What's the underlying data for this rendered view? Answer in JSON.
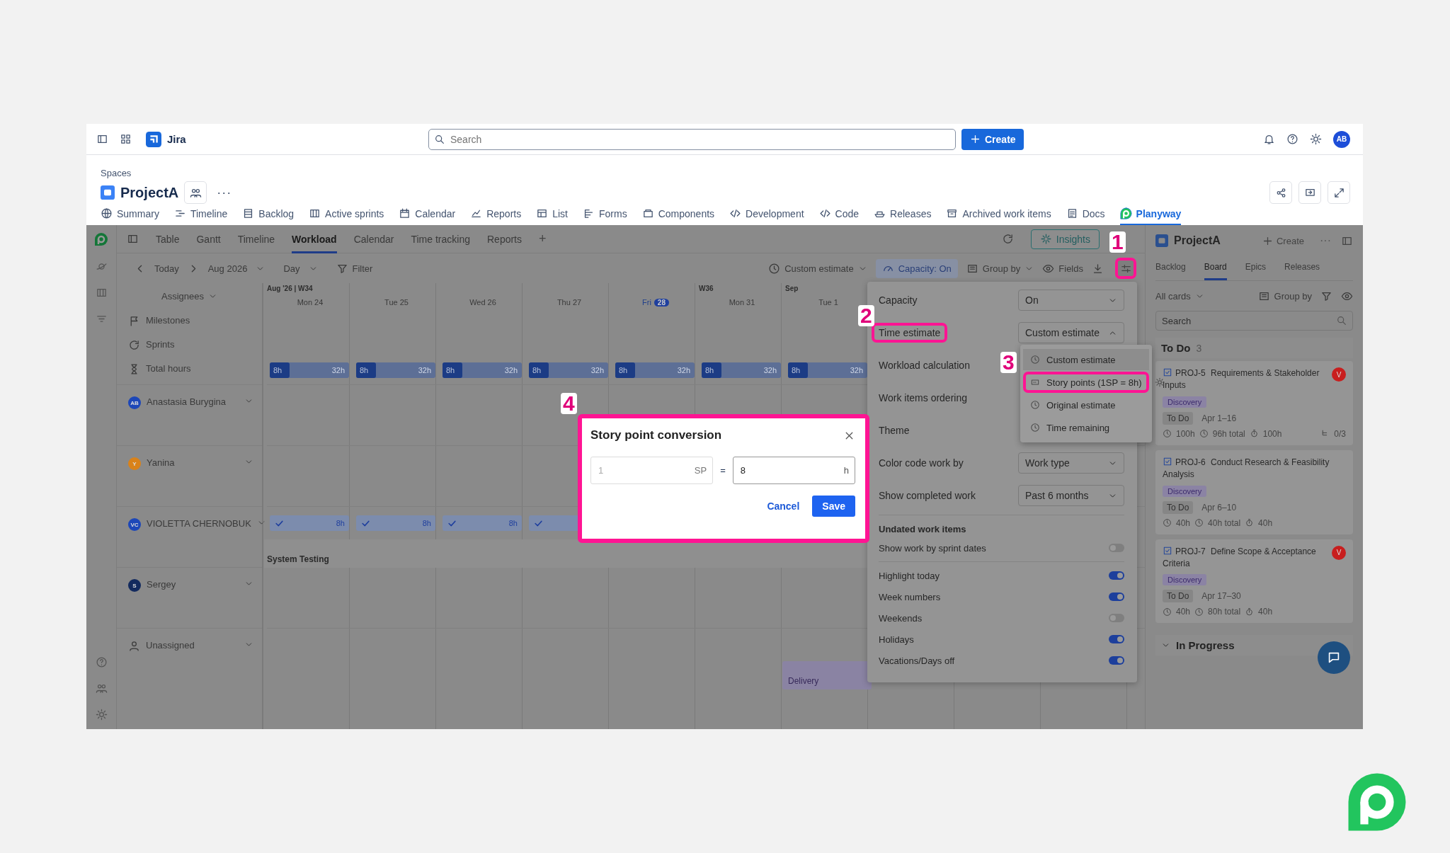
{
  "topbar": {
    "app_name": "Jira",
    "search_placeholder": "Search",
    "create_label": "Create",
    "avatar": "AB"
  },
  "space": {
    "breadcrumb": "Spaces",
    "name": "ProjectA",
    "more": "···"
  },
  "space_tabs": [
    {
      "label": "Summary",
      "selected": false
    },
    {
      "label": "Timeline",
      "selected": false
    },
    {
      "label": "Backlog",
      "selected": false
    },
    {
      "label": "Active sprints",
      "selected": false
    },
    {
      "label": "Calendar",
      "selected": false
    },
    {
      "label": "Reports",
      "selected": false
    },
    {
      "label": "List",
      "selected": false
    },
    {
      "label": "Forms",
      "selected": false
    },
    {
      "label": "Components",
      "selected": false
    },
    {
      "label": "Development",
      "selected": false
    },
    {
      "label": "Code",
      "selected": false
    },
    {
      "label": "Releases",
      "selected": false
    },
    {
      "label": "Archived work items",
      "selected": false
    },
    {
      "label": "Docs",
      "selected": false
    },
    {
      "label": "Planyway",
      "selected": true
    }
  ],
  "views": {
    "tabs": [
      {
        "label": "Table",
        "selected": false
      },
      {
        "label": "Gantt",
        "selected": false
      },
      {
        "label": "Timeline",
        "selected": false
      },
      {
        "label": "Workload",
        "selected": true
      },
      {
        "label": "Calendar",
        "selected": false
      },
      {
        "label": "Time tracking",
        "selected": false
      },
      {
        "label": "Reports",
        "selected": false
      }
    ],
    "add": "+",
    "insights": "Insights"
  },
  "toolbar": {
    "today": "Today",
    "month": "Aug 2026",
    "scale": "Day",
    "filter": "Filter",
    "estimate": "Custom estimate",
    "capacity": "Capacity: On",
    "group_by": "Group by",
    "fields": "Fields",
    "settings_highlighted": true
  },
  "workload": {
    "assignees_label": "Assignees",
    "days": [
      {
        "week": "Aug '26 | W34",
        "weekday": "Mon",
        "date": "24",
        "today": false
      },
      {
        "weekday": "Tue",
        "date": "25",
        "today": false
      },
      {
        "weekday": "Wed",
        "date": "26",
        "today": false
      },
      {
        "weekday": "Thu",
        "date": "27",
        "today": false
      },
      {
        "weekday": "Fri",
        "date": "28",
        "today": true
      },
      {
        "week": "W36",
        "weekday": "Mon",
        "date": "31",
        "today": false
      },
      {
        "week": "Sep",
        "weekday": "Tue",
        "date": "1",
        "today": false
      }
    ],
    "rows": [
      {
        "kind": "milestones",
        "label": "Milestones"
      },
      {
        "kind": "sprints",
        "label": "Sprints"
      },
      {
        "kind": "total",
        "label": "Total hours",
        "bars": [
          {
            "used": "8h",
            "capacity": "32h",
            "level": 0.25
          },
          {
            "used": "8h",
            "capacity": "32h",
            "level": 0.25
          },
          {
            "used": "8h",
            "capacity": "32h",
            "level": 0.25
          },
          {
            "used": "8h",
            "capacity": "32h",
            "level": 0.25
          },
          {
            "used": "8h",
            "capacity": "32h",
            "level": 0.25
          },
          {
            "used": "8h",
            "capacity": "32h",
            "level": 0.25
          },
          {
            "used": "8h",
            "capacity": "32h",
            "level": 0.25
          }
        ]
      },
      {
        "kind": "person",
        "name": "Anastasia Burygina",
        "initials": "AB",
        "color": "#1d47b8"
      },
      {
        "kind": "person",
        "name": "Yanina",
        "initials": "Y",
        "color": "#d9821a"
      },
      {
        "kind": "person",
        "name": "VIOLETTA CHERNOBUK",
        "initials": "VC",
        "color": "#1d47b8",
        "bars": [
          {
            "kind": "check",
            "hours": "8h"
          },
          {
            "kind": "check",
            "hours": "8h"
          },
          {
            "kind": "check",
            "hours": "8h"
          },
          {
            "kind": "check"
          }
        ],
        "tasks": [
          {
            "label": "System Testing"
          }
        ]
      },
      {
        "kind": "person",
        "name": "Sergey",
        "initials": "S",
        "color": "#132a5e"
      },
      {
        "kind": "unassigned",
        "name": "Unassigned",
        "tasks": [
          {
            "label": "Delivery"
          }
        ]
      }
    ]
  },
  "settings": {
    "selects": [
      {
        "label": "Capacity",
        "value": "On",
        "expanded": false,
        "highlighted": false
      },
      {
        "label": "Time estimate",
        "value": "Custom estimate",
        "expanded": true,
        "highlighted": true,
        "options": [
          {
            "label": "Custom estimate",
            "selected": true,
            "highlighted": false
          },
          {
            "label": "Story points (1SP = 8h)",
            "selected": false,
            "highlighted": true,
            "has_settings": true
          },
          {
            "label": "Original estimate",
            "selected": false,
            "highlighted": false
          },
          {
            "label": "Time remaining",
            "selected": false,
            "highlighted": false
          }
        ]
      },
      {
        "label": "Workload calculation",
        "highlighted": false
      },
      {
        "label": "Work items ordering",
        "highlighted": false
      },
      {
        "label": "Theme",
        "highlighted": false
      },
      {
        "label": "Color code work by",
        "value": "Work type",
        "expanded": false,
        "highlighted": false
      },
      {
        "label": "Show completed work",
        "value": "Past 6 months",
        "expanded": false,
        "highlighted": false
      }
    ],
    "section": "Undated work items",
    "undated_toggles": [
      {
        "label": "Show work by sprint dates",
        "on": false
      }
    ],
    "toggles": [
      {
        "label": "Highlight today",
        "on": true
      },
      {
        "label": "Week numbers",
        "on": true
      },
      {
        "label": "Weekends",
        "on": false
      },
      {
        "label": "Holidays",
        "on": true
      },
      {
        "label": "Vacations/Days off",
        "on": true
      }
    ]
  },
  "right_panel": {
    "title": "ProjectA",
    "create": "Create",
    "more": "···",
    "tabs": [
      {
        "label": "Backlog",
        "selected": false
      },
      {
        "label": "Board",
        "selected": true
      },
      {
        "label": "Epics",
        "selected": false
      },
      {
        "label": "Releases",
        "selected": false
      }
    ],
    "filter": "All cards",
    "group_by": "Group by",
    "search_placeholder": "Search",
    "columns": [
      {
        "title": "To Do",
        "count": "3",
        "expanded": true,
        "cards": [
          {
            "key": "PROJ-5",
            "title": "Requirements & Stakeholder Inputs",
            "assignee": "V",
            "color": "#c81e1e",
            "tag": "Discovery",
            "status": "To Do",
            "dates": "Apr 1–16",
            "estimate": "100h",
            "total": "96h total",
            "remaining": "100h",
            "subtasks": "0/3"
          },
          {
            "key": "PROJ-6",
            "title": "Conduct Research & Feasibility Analysis",
            "tag": "Discovery",
            "status": "To Do",
            "dates": "Apr 6–10",
            "estimate": "40h",
            "total": "40h total",
            "remaining": "40h"
          },
          {
            "key": "PROJ-7",
            "title": "Define Scope & Acceptance Criteria",
            "assignee": "V",
            "color": "#c81e1e",
            "tag": "Discovery",
            "status": "To Do",
            "dates": "Apr 17–30",
            "estimate": "40h",
            "total": "80h total",
            "remaining": "40h"
          }
        ]
      },
      {
        "title": "In Progress",
        "expanded": false
      }
    ]
  },
  "modal": {
    "title": "Story point conversion",
    "points": "1",
    "points_disabled": true,
    "points_unit": "SP",
    "equals": "=",
    "hours": "8",
    "hours_unit": "h",
    "cancel": "Cancel",
    "save": "Save"
  },
  "annotations": [
    "1",
    "2",
    "3",
    "4"
  ]
}
